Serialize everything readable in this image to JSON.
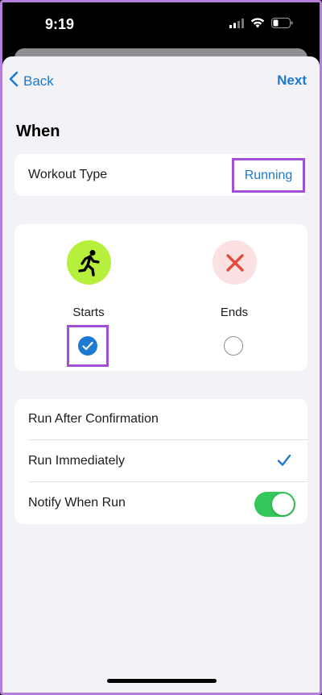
{
  "status_bar": {
    "time": "9:19"
  },
  "nav": {
    "back_label": "Back",
    "next_label": "Next"
  },
  "section": {
    "title": "When"
  },
  "workout": {
    "label": "Workout Type",
    "value": "Running"
  },
  "events": [
    {
      "label": "Starts",
      "icon": "running-figure-icon",
      "color": "#b6f03c",
      "selected": true
    },
    {
      "label": "Ends",
      "icon": "x-icon",
      "color": "#fbe1e1",
      "selected": false
    }
  ],
  "options": [
    {
      "label": "Run After Confirmation"
    },
    {
      "label": "Run Immediately",
      "checked": true
    },
    {
      "label": "Notify When Run",
      "toggle_on": true
    }
  ],
  "colors": {
    "accent": "#1c7ad0",
    "toggle_on": "#34c759",
    "highlight": "#a24fd6"
  }
}
